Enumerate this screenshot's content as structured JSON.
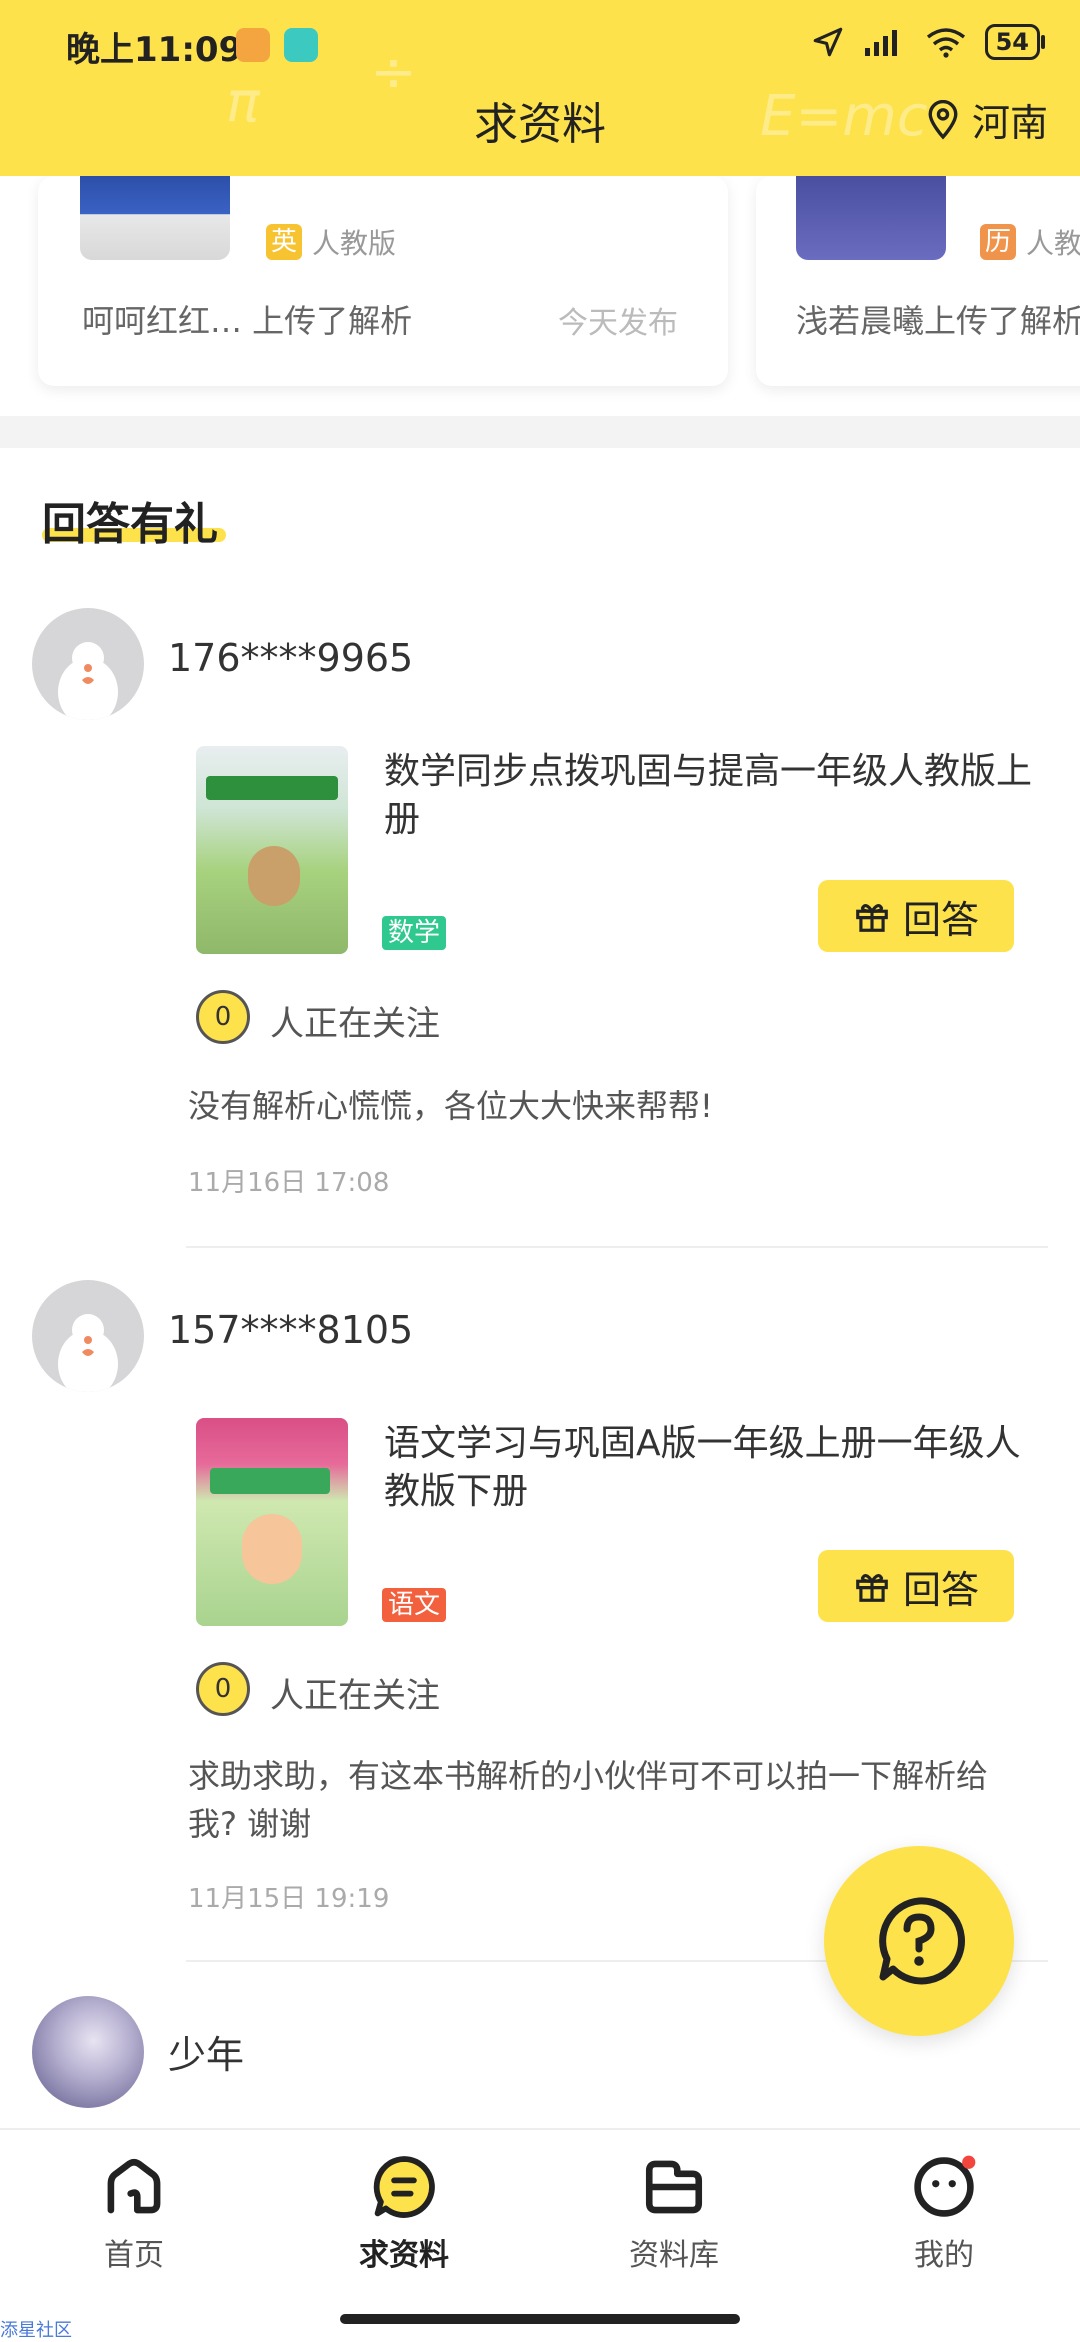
{
  "status_bar": {
    "time": "晚上11:09",
    "battery": "54"
  },
  "header": {
    "title": "求资料",
    "location": "河南",
    "colors": {
      "accent": "#fde24c"
    }
  },
  "featured_cards": [
    {
      "subject": "英",
      "subject_color": "#f7c331",
      "edition": "人教版",
      "uploader_text": "呵呵红红… 上传了解析",
      "published": "今天发布"
    },
    {
      "subject": "历",
      "subject_color": "#f0944b",
      "edition": "人教",
      "uploader_text": "浅若晨曦上传了解析"
    }
  ],
  "section": {
    "title": "回答有礼"
  },
  "posts": [
    {
      "username": "176****9965",
      "book_title": "数学同步点拨巩固与提高一年级人教版上册",
      "tag": "数学",
      "tag_color": "#2fc98f",
      "answer_label": "回答",
      "watchers": "0",
      "watch_text": "人正在关注",
      "body": "没有解析心慌慌，各位大大快来帮帮!",
      "time": "11月16日 17:08"
    },
    {
      "username": "157****8105",
      "book_title": "语文学习与巩固A版一年级上册一年级人教版下册",
      "tag": "语文",
      "tag_color": "#f2603d",
      "answer_label": "回答",
      "watchers": "0",
      "watch_text": "人正在关注",
      "body": "求助求助，有这本书解析的小伙伴可不可以拍一下解析给我? 谢谢",
      "time": "11月15日 19:19"
    },
    {
      "username": "少年"
    }
  ],
  "fab": {
    "icon": "question-bubble-icon"
  },
  "bottom_nav": [
    {
      "label": "首页",
      "icon": "home-icon",
      "active": false
    },
    {
      "label": "求资料",
      "icon": "chat-bubble-icon",
      "active": true
    },
    {
      "label": "资料库",
      "icon": "folder-icon",
      "active": false
    },
    {
      "label": "我的",
      "icon": "profile-face-icon",
      "active": false,
      "badge": true
    }
  ],
  "watermark": "添星社区"
}
